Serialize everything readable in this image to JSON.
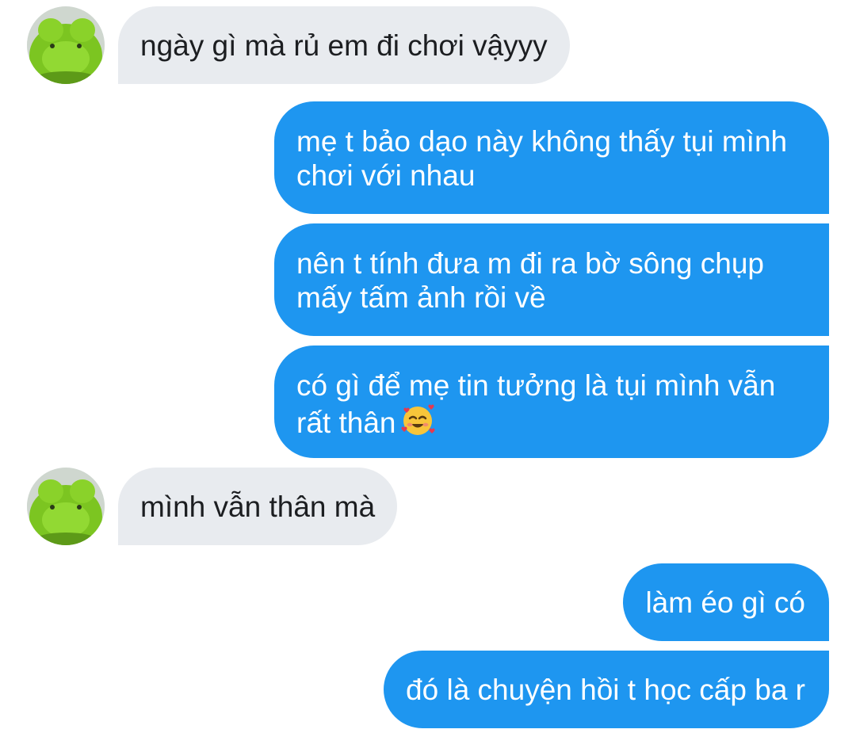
{
  "conversation": {
    "messages": [
      {
        "sender": "contact",
        "text": "ngày gì mà rủ em đi chơi vậyyy"
      },
      {
        "sender": "me",
        "text": "mẹ t bảo dạo này không thấy tụi mình chơi với nhau"
      },
      {
        "sender": "me",
        "text": "nên t tính đưa m đi ra bờ sông chụp mấy tấm ảnh rồi về"
      },
      {
        "sender": "me",
        "text": "có gì để mẹ tin tưởng là tụi mình vẫn rất thân",
        "emoji": "smiling-face-with-hearts"
      },
      {
        "sender": "contact",
        "text": "mình vẫn thân mà"
      },
      {
        "sender": "me",
        "text": "làm éo gì có"
      },
      {
        "sender": "me",
        "text": "đó là chuyện hồi t học cấp ba r"
      }
    ]
  },
  "contact": {
    "avatar_icon": "frog-plush-avatar"
  },
  "colors": {
    "outgoing_bubble": "#1e96f0",
    "incoming_bubble": "#e8ebef",
    "outgoing_text": "#ffffff",
    "incoming_text": "#1c1e21",
    "background": "#ffffff"
  }
}
